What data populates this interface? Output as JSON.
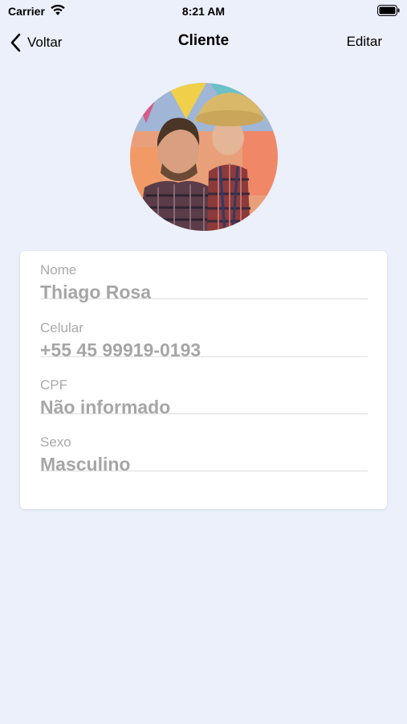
{
  "status_bar": {
    "carrier": "Carrier",
    "time": "8:21 AM",
    "icons": [
      "wifi-icon",
      "battery-icon"
    ]
  },
  "nav": {
    "back_label": "Voltar",
    "title": "Cliente",
    "edit_label": "Editar"
  },
  "profile": {
    "fields": [
      {
        "label": "Nome",
        "value": "Thiago Rosa"
      },
      {
        "label": "Celular",
        "value": "+55 45 99919-0193"
      },
      {
        "label": "CPF",
        "value": "Não informado"
      },
      {
        "label": "Sexo",
        "value": "Masculino"
      }
    ]
  },
  "colors": {
    "background": "#ecf0fb",
    "card": "#ffffff",
    "label": "#a9a9a9",
    "value": "#a6a6a6"
  }
}
